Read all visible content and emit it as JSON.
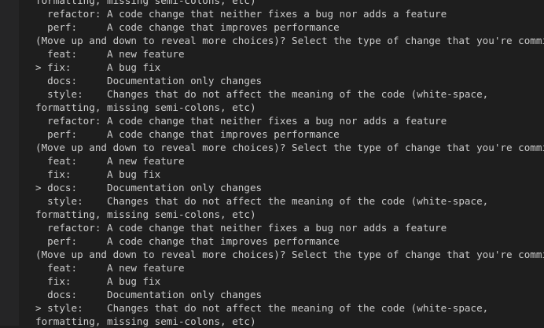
{
  "terminal": {
    "lines": [
      "formatting, missing semi-colons, etc)",
      "  refactor: A code change that neither fixes a bug nor adds a feature",
      "  perf:     A code change that improves performance",
      "(Move up and down to reveal more choices)? Select the type of change that you're committing:",
      "  feat:     A new feature",
      "> fix:      A bug fix",
      "  docs:     Documentation only changes",
      "  style:    Changes that do not affect the meaning of the code (white-space,",
      "formatting, missing semi-colons, etc)",
      "  refactor: A code change that neither fixes a bug nor adds a feature",
      "  perf:     A code change that improves performance",
      "(Move up and down to reveal more choices)? Select the type of change that you're committing:",
      "  feat:     A new feature",
      "  fix:      A bug fix",
      "> docs:     Documentation only changes",
      "  style:    Changes that do not affect the meaning of the code (white-space,",
      "formatting, missing semi-colons, etc)",
      "  refactor: A code change that neither fixes a bug nor adds a feature",
      "  perf:     A code change that improves performance",
      "(Move up and down to reveal more choices)? Select the type of change that you're committing:",
      "  feat:     A new feature",
      "  fix:      A bug fix",
      "  docs:     Documentation only changes",
      "> style:    Changes that do not affect the meaning of the code (white-space,",
      "formatting, missing semi-colons, etc)"
    ]
  },
  "colors": {
    "background": "#1e1e1e",
    "gutter": "#252526",
    "text": "#cccccc"
  }
}
